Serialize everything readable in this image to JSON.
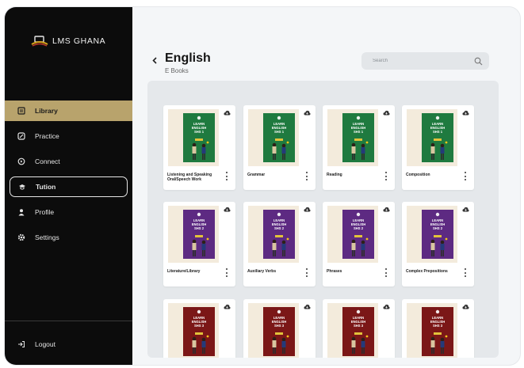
{
  "app": {
    "name": "LMS GHANA"
  },
  "colors": {
    "sidebar": "#0c0c0c",
    "accent": "#b8a36c",
    "green": "#1f7a3f",
    "purple": "#5d2a82",
    "maroon": "#7b1717"
  },
  "sidebar": {
    "items": [
      {
        "label": "Library",
        "icon": "library-icon"
      },
      {
        "label": "Practice",
        "icon": "practice-icon"
      },
      {
        "label": "Connect",
        "icon": "connect-icon"
      },
      {
        "label": "Tution",
        "icon": "tuition-icon"
      },
      {
        "label": "Profile",
        "icon": "profile-icon"
      },
      {
        "label": "Settings",
        "icon": "settings-icon"
      }
    ],
    "logout": "Logout"
  },
  "header": {
    "title": "English",
    "subtitle": "E Books"
  },
  "search": {
    "placeholder": "Search"
  },
  "books": [
    {
      "label": "Listening and Speaking Oral/Speech Work",
      "cover": [
        "LEARN",
        "ENGLISH",
        "SHS 1"
      ],
      "color": "green"
    },
    {
      "label": "Grammar",
      "cover": [
        "LEARN",
        "ENGLISH",
        "SHS 1"
      ],
      "color": "green"
    },
    {
      "label": "Reading",
      "cover": [
        "LEARN",
        "ENGLISH",
        "SHS 1"
      ],
      "color": "green"
    },
    {
      "label": "Composition",
      "cover": [
        "LEARN",
        "ENGLISH",
        "SHS 1"
      ],
      "color": "green"
    },
    {
      "label": "Literature/Library",
      "cover": [
        "LEARN",
        "ENGLISH",
        "SHS 2"
      ],
      "color": "purple"
    },
    {
      "label": "Auxiliary Verbs",
      "cover": [
        "LEARN",
        "ENGLISH",
        "SHS 2"
      ],
      "color": "purple"
    },
    {
      "label": "Phrases",
      "cover": [
        "LEARN",
        "ENGLISH",
        "SHS 2"
      ],
      "color": "purple"
    },
    {
      "label": "Complex Prepositions",
      "cover": [
        "LEARN",
        "ENGLISH",
        "SHS 2"
      ],
      "color": "purple"
    },
    {
      "label": "",
      "cover": [
        "LEARN",
        "ENGLISH",
        "SHS 3"
      ],
      "color": "maroon"
    },
    {
      "label": "",
      "cover": [
        "LEARN",
        "ENGLISH",
        "SHS 3"
      ],
      "color": "maroon"
    },
    {
      "label": "",
      "cover": [
        "LEARN",
        "ENGLISH",
        "SHS 3"
      ],
      "color": "maroon"
    },
    {
      "label": "",
      "cover": [
        "LEARN",
        "ENGLISH",
        "SHS 3"
      ],
      "color": "maroon"
    }
  ]
}
